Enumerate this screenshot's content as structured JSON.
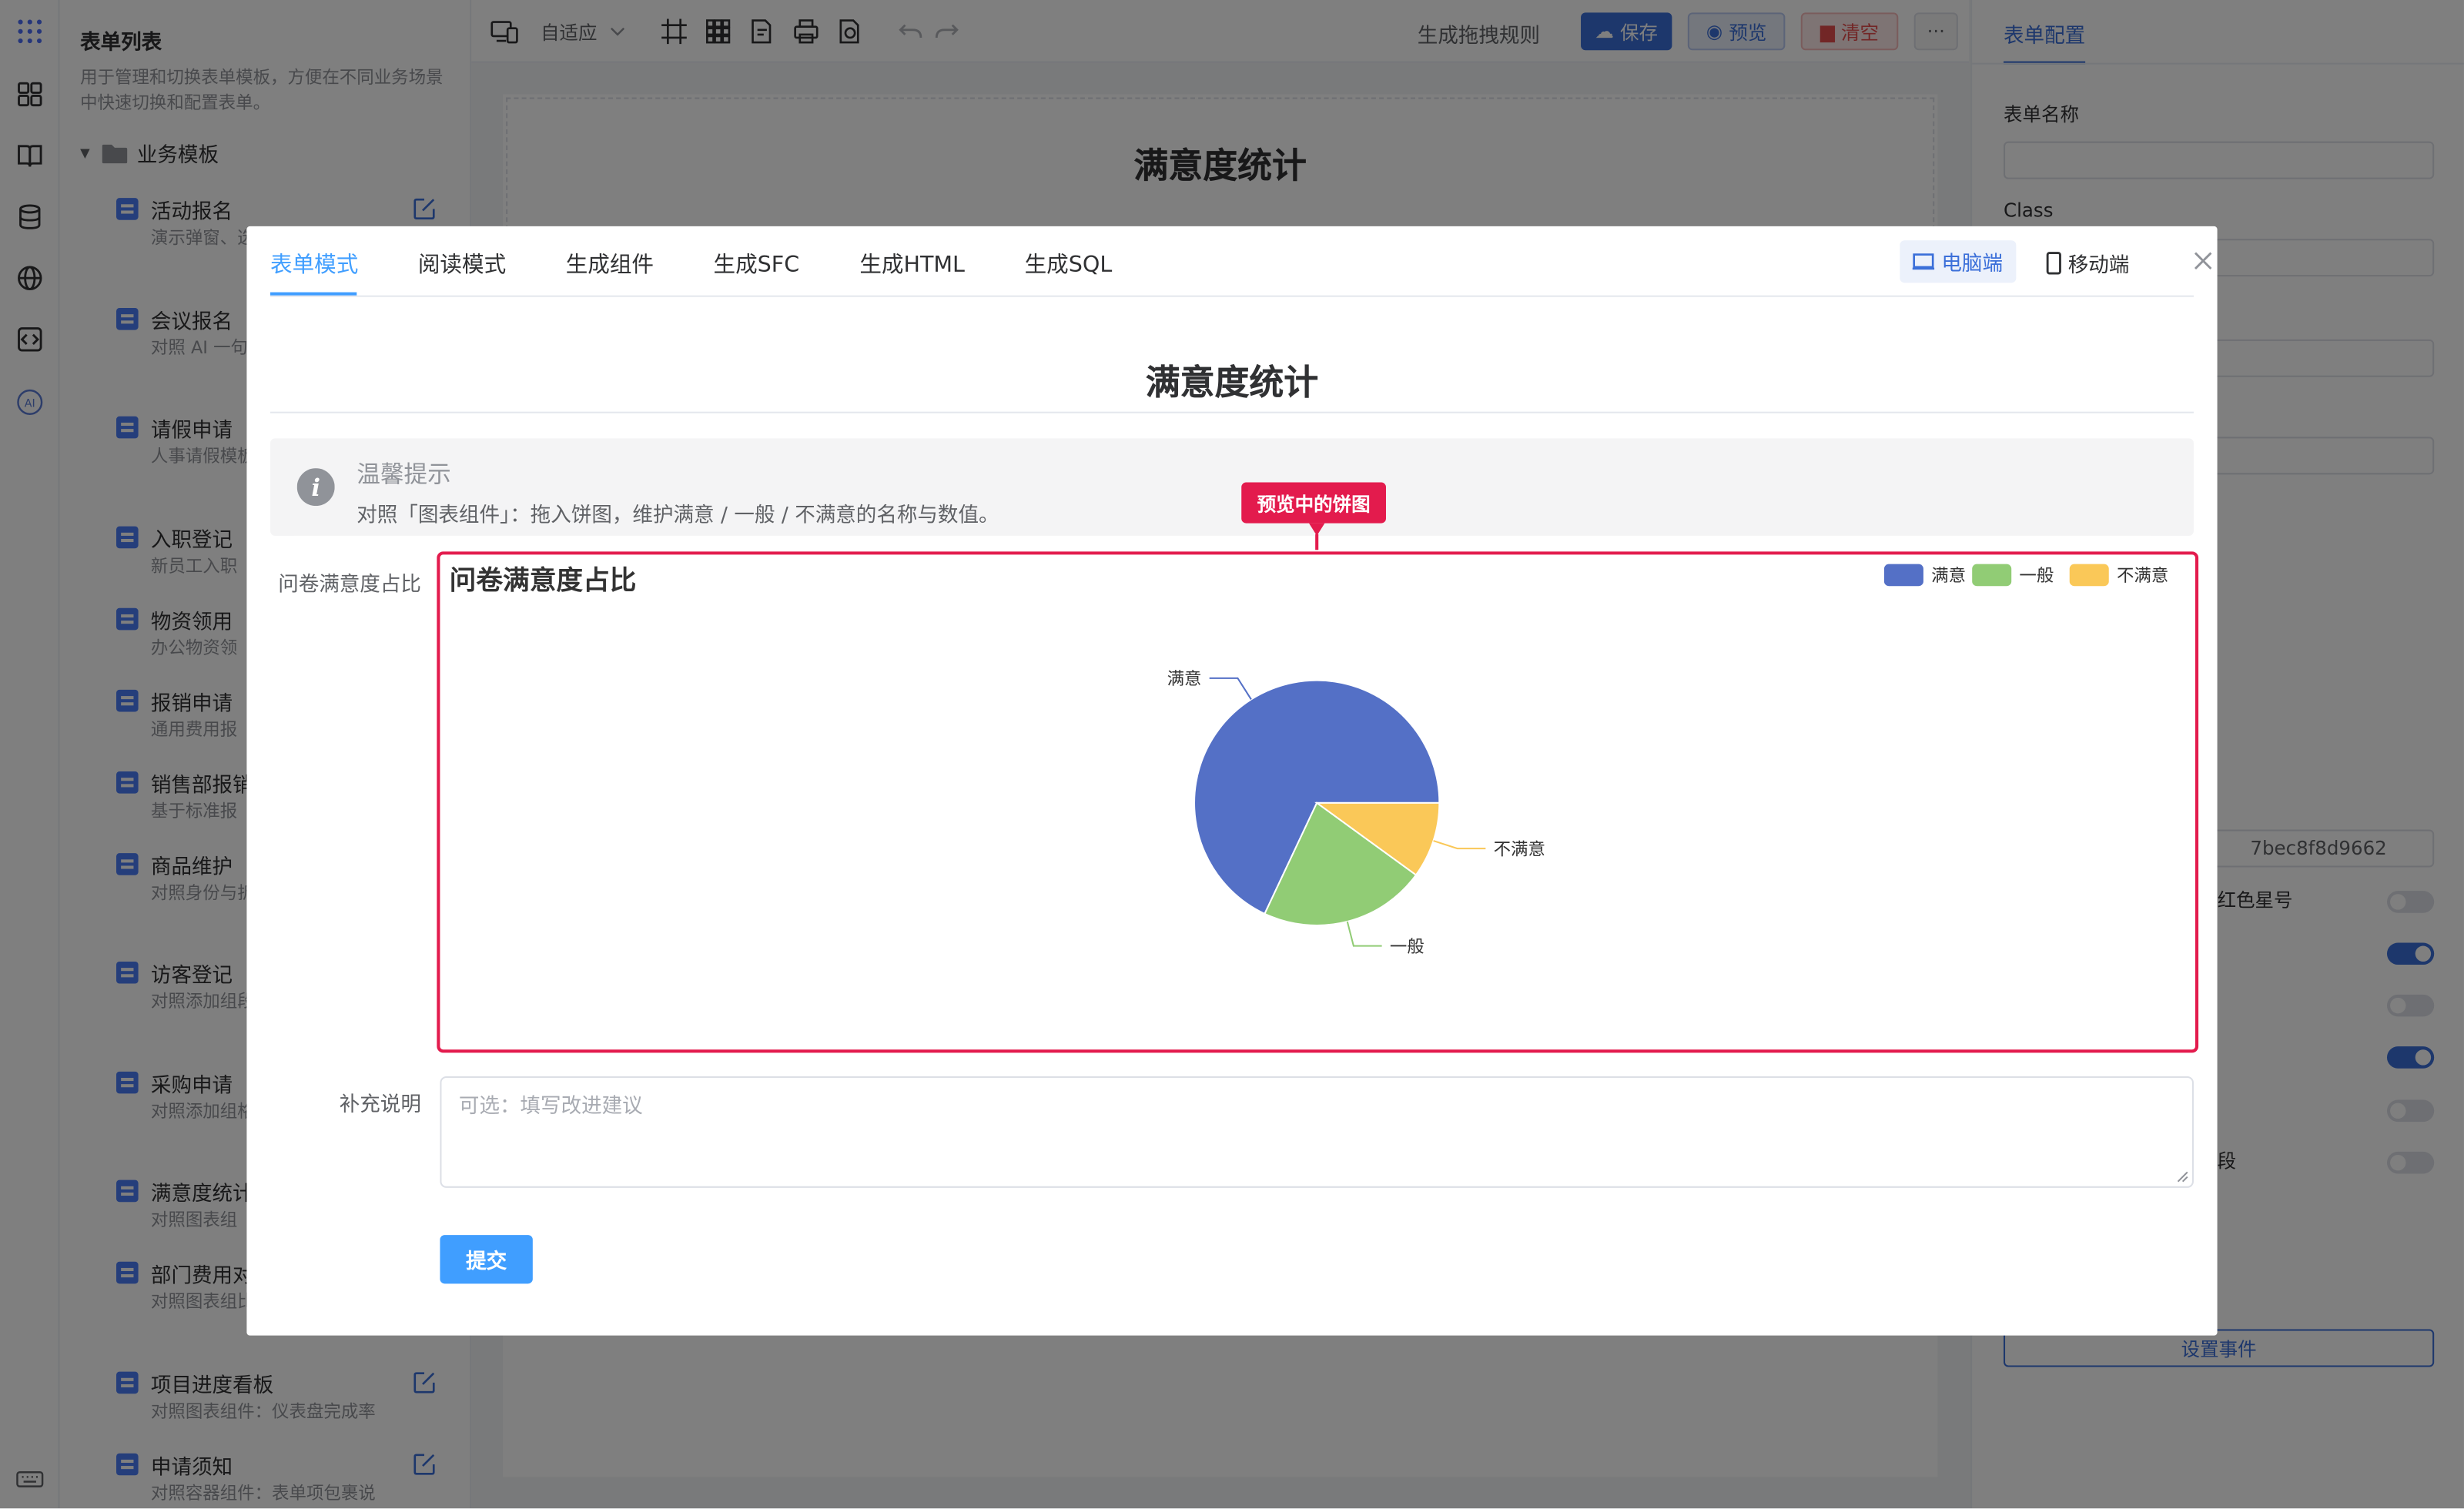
{
  "sidebar": {
    "title": "表单列表",
    "description": "用于管理和切换表单模板，方便在不同业务场景中快速切换和配置表单。",
    "folder_label": "业务模板",
    "items": [
      {
        "name": "活动报名",
        "desc": "演示弹窗、选品回填、"
      },
      {
        "name": "会议报名",
        "desc": "对照 AI 一句机号、公司"
      },
      {
        "name": "请假申请",
        "desc": "人事请假模板理人等字段"
      },
      {
        "name": "入职登记",
        "desc": "新员工入职"
      },
      {
        "name": "物资领用",
        "desc": "办公物资领"
      },
      {
        "name": "报销申请",
        "desc": "通用费用报"
      },
      {
        "name": "销售部报销",
        "desc": "基于标准报"
      },
      {
        "name": "商品维护",
        "desc": "对照身份与折扣率、审"
      },
      {
        "name": "访客登记",
        "desc": "对照添加组段、设必填"
      },
      {
        "name": "采购申请",
        "desc": "对照添加组格表单明细"
      },
      {
        "name": "满意度统计",
        "desc": "对照图表组"
      },
      {
        "name": "部门费用对比",
        "desc": "对照图表组比"
      },
      {
        "name": "项目进度看板",
        "desc": "对照图表组件：仪表盘完成率"
      },
      {
        "name": "申请须知",
        "desc": "对照容器组件：表单项包裹说"
      }
    ]
  },
  "toolbar": {
    "adapt_label": "自适应",
    "rule_label": "生成拖拽规则",
    "save_label": "保存",
    "preview_label": "预览",
    "clear_label": "清空",
    "more_label": "···"
  },
  "canvas": {
    "title": "满意度统计"
  },
  "right_panel": {
    "tab": "表单配置",
    "form_name_label": "表单名称",
    "class_label": "Class",
    "id_partial": "7bec8f8d9662",
    "red_star_partial": "红色星号",
    "field_partial": "段",
    "event_button": "设置事件"
  },
  "modal": {
    "tabs": [
      "表单模式",
      "阅读模式",
      "生成组件",
      "生成SFC",
      "生成HTML",
      "生成SQL"
    ],
    "active_tab": 0,
    "device_pc": "电脑端",
    "device_mobile": "移动端",
    "form_title": "满意度统计",
    "tip_title": "温馨提示",
    "tip_desc": "对照「图表组件」：拖入饼图，维护满意 / 一般 / 不满意的名称与数值。",
    "chart_field_label": "问卷满意度占比",
    "callout": "预览中的饼图",
    "remark_label": "补充说明",
    "remark_placeholder": "可选：填写改进建议",
    "submit_label": "提交"
  },
  "chart_data": {
    "type": "pie",
    "title": "问卷满意度占比",
    "legend_position": "top-right",
    "categories": [
      "满意",
      "一般",
      "不满意"
    ],
    "values": [
      68,
      22,
      10
    ],
    "colors": [
      "#5470c6",
      "#91cc75",
      "#fac858"
    ]
  },
  "colors": {
    "accent": "#409eff",
    "primary_button": "#3b6fd9",
    "highlight": "#e31b4d"
  }
}
